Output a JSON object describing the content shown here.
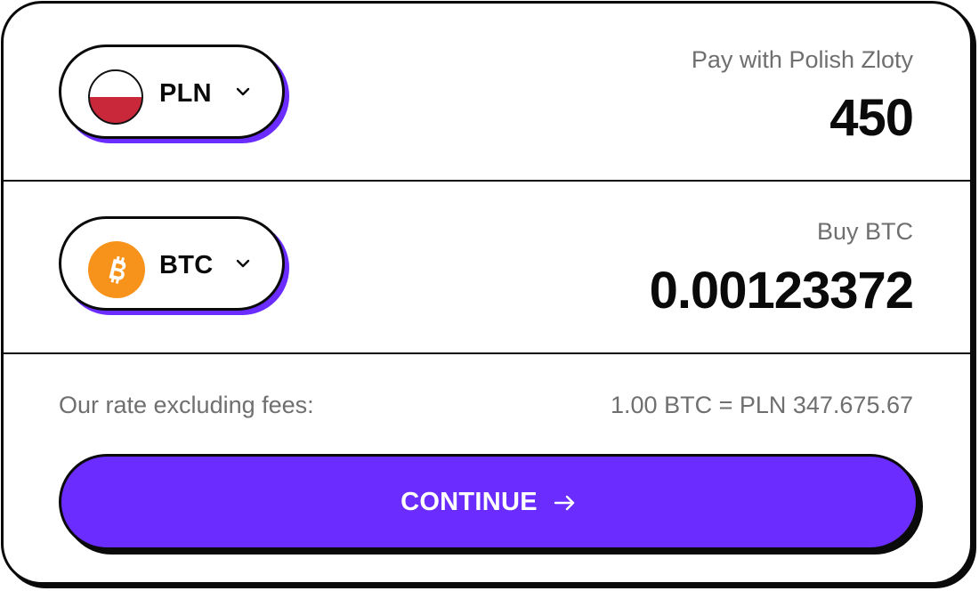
{
  "colors": {
    "accent": "#6a2cff",
    "border": "#0a0a0a",
    "muted_text": "#6f6f6f",
    "pln_flag_red": "#c8283a",
    "btc_orange": "#f7931a"
  },
  "pay": {
    "currency_code": "PLN",
    "currency_icon": "poland-flag-icon",
    "label": "Pay with Polish Zloty",
    "amount": "450"
  },
  "buy": {
    "currency_code": "BTC",
    "currency_icon": "bitcoin-icon",
    "label": "Buy BTC",
    "amount": "0.00123372"
  },
  "rate": {
    "label": "Our rate excluding fees:",
    "value": "1.00 BTC = PLN 347.675.67"
  },
  "continue_button": {
    "label": "CONTINUE",
    "icon": "arrow-right-icon"
  }
}
